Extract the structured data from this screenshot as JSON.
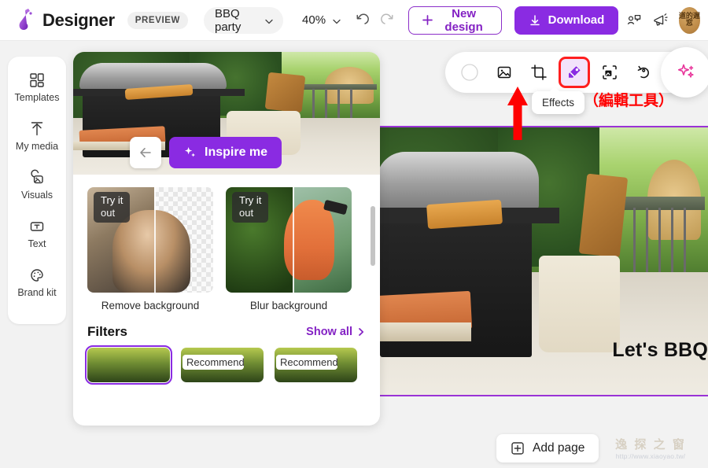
{
  "header": {
    "logo_icon": "designer-logo-icon",
    "app_title": "Designer",
    "preview_badge": "PREVIEW",
    "document_name": "BBQ party",
    "document_chevron_icon": "chevron-down-icon",
    "zoom_level": "40%",
    "zoom_chevron_icon": "chevron-down-icon",
    "undo_icon": "undo-icon",
    "redo_icon": "redo-icon",
    "new_design_label": "New design",
    "new_design_icon": "plus-icon",
    "download_label": "Download",
    "download_icon": "download-arrow-icon",
    "collaborate_icon": "collaborate-icon",
    "announcements_icon": "megaphone-icon",
    "avatar_label": "道的遅窓",
    "avatar_name": "user-avatar"
  },
  "sidebar": {
    "items": [
      {
        "icon": "templates-grid-icon",
        "label": "Templates"
      },
      {
        "icon": "upload-arrow-icon",
        "label": "My media"
      },
      {
        "icon": "visuals-image-icon",
        "label": "Visuals"
      },
      {
        "icon": "text-box-icon",
        "label": "Text"
      },
      {
        "icon": "palette-icon",
        "label": "Brand kit"
      }
    ]
  },
  "toolbar": {
    "items": [
      {
        "icon": "color-swatch-circle-icon",
        "name": "background-color-tool",
        "selected": false
      },
      {
        "icon": "image-picture-icon",
        "name": "replace-image-tool",
        "selected": false
      },
      {
        "icon": "crop-icon",
        "name": "crop-tool",
        "selected": false
      },
      {
        "icon": "effects-icon",
        "name": "effects-tool",
        "selected": true
      },
      {
        "icon": "remove-background-icon",
        "name": "remove-background-tool",
        "selected": false
      },
      {
        "icon": "rotate-icon",
        "name": "rotate-tool",
        "selected": false
      },
      {
        "icon": "contrast-icon",
        "name": "adjust-tool",
        "selected": false
      }
    ],
    "magic_icon": "sparkle-magic-icon",
    "tooltip_text": "Effects",
    "selection_outline_color": "#ff1f1f",
    "selected_chip_bg": "#f3e3fb"
  },
  "annotation": {
    "text": "（編輯工具）",
    "color": "#ff0000",
    "arrow_icon": "red-up-arrow-icon"
  },
  "panel": {
    "hero": {
      "back_icon": "arrow-left-icon",
      "inspire_icon": "sparkle-icon",
      "inspire_label": "Inspire me"
    },
    "cards": [
      {
        "badge_line1": "Try it",
        "badge_line2": "out",
        "label": "Remove background"
      },
      {
        "badge_line1": "Try it",
        "badge_line2": "out",
        "label": "Blur background"
      }
    ],
    "filters": {
      "title": "Filters",
      "show_all_label": "Show all",
      "show_all_icon": "chevron-right-icon",
      "thumbs": [
        {
          "tag": "",
          "selected": true
        },
        {
          "tag": "Recommended",
          "selected": false
        },
        {
          "tag": "Recommended",
          "selected": false
        }
      ]
    }
  },
  "canvas": {
    "design_text": "Let's BBQ",
    "border_color": "#9a33d6"
  },
  "footer": {
    "add_page_label": "Add page",
    "add_page_icon": "plus-square-icon"
  },
  "watermark": {
    "glyphs": "逸 探 之 窗",
    "url": "http://www.xiaoyao.tw/"
  },
  "colors": {
    "accent_purple": "#8a2be2",
    "accent_purple_dark": "#8422c4",
    "page_bg": "#f2f2f2",
    "panel_bg": "#ffffff"
  }
}
